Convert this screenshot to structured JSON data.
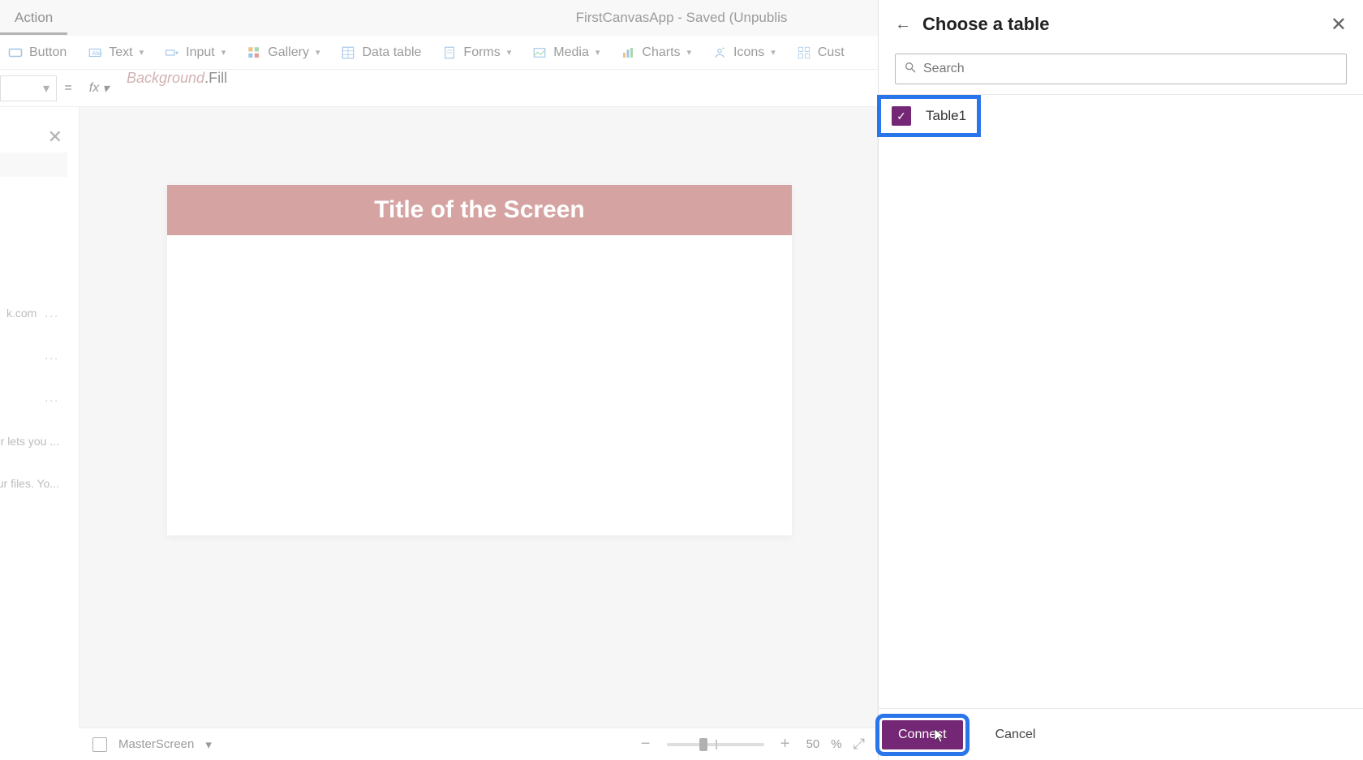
{
  "titlebar": {
    "active_tab": "Action",
    "app_title": "FirstCanvasApp - Saved (Unpublis"
  },
  "ribbon": {
    "button": "Button",
    "text": "Text",
    "input": "Input",
    "gallery": "Gallery",
    "data_table": "Data table",
    "forms": "Forms",
    "media": "Media",
    "charts": "Charts",
    "icons": "Icons",
    "custom": "Cust"
  },
  "formula": {
    "eq": "=",
    "fx": "fx",
    "expr_back": "Background",
    "expr_fill": ".Fill"
  },
  "leftpane": {
    "rows": [
      {
        "text": "k.com",
        "more": "..."
      },
      {
        "text": "",
        "more": "..."
      },
      {
        "text": "",
        "more": "..."
      },
      {
        "text": "ovider lets you ...",
        "more": ""
      },
      {
        "text": "e your files. Yo...",
        "more": ""
      }
    ]
  },
  "canvas": {
    "screen_title": "Title of the Screen"
  },
  "statusbar": {
    "screen_name": "MasterScreen",
    "zoom_minus": "−",
    "zoom_plus": "+",
    "zoom_value": "50",
    "zoom_unit": "%"
  },
  "rightpanel": {
    "title": "Choose a table",
    "search_placeholder": "Search",
    "tables": [
      {
        "name": "Table1",
        "checked": true
      }
    ],
    "connect_label": "Connect",
    "cancel_label": "Cancel"
  }
}
